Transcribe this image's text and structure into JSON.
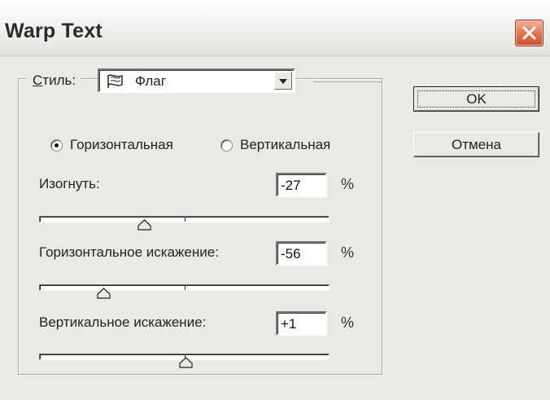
{
  "window": {
    "title": "Warp Text"
  },
  "style": {
    "label_ul": "С",
    "label_rest": "тиль:",
    "selected": "Флаг",
    "icon": "flag-icon"
  },
  "orientation": {
    "options": [
      "Горизонтальная",
      "Вертикальная"
    ],
    "selected": "Горизонтальная"
  },
  "bend": {
    "label": "Изогнуть:",
    "value": "-27",
    "unit": "%",
    "percent": -27
  },
  "horizontal_distortion": {
    "label": "Горизонтальное искажение:",
    "value": "-56",
    "unit": "%",
    "percent": -56
  },
  "vertical_distortion": {
    "label": "Вертикальное искажение:",
    "value": "+1",
    "unit": "%",
    "percent": 1
  },
  "buttons": {
    "ok": "OK",
    "cancel": "Отмена"
  },
  "colors": {
    "close_button": "#e0734f",
    "dialog_bg": "#ebe9e4"
  }
}
